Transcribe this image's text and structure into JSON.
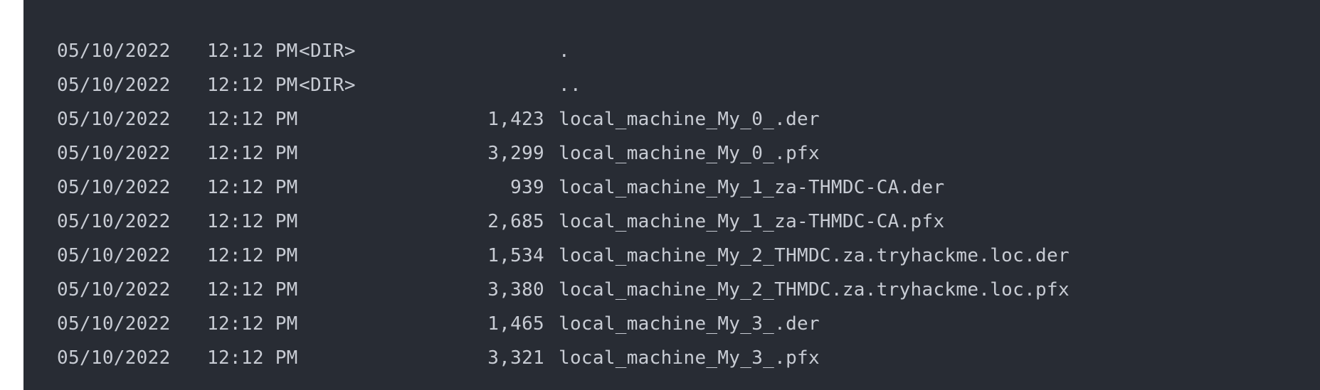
{
  "listing": {
    "rows": [
      {
        "date": "05/10/2022",
        "time": "12:12 PM",
        "dir": "<DIR>",
        "size": "",
        "name": "."
      },
      {
        "date": "05/10/2022",
        "time": "12:12 PM",
        "dir": "<DIR>",
        "size": "",
        "name": ".."
      },
      {
        "date": "05/10/2022",
        "time": "12:12 PM",
        "dir": "",
        "size": "1,423",
        "name": "local_machine_My_0_.der"
      },
      {
        "date": "05/10/2022",
        "time": "12:12 PM",
        "dir": "",
        "size": "3,299",
        "name": "local_machine_My_0_.pfx"
      },
      {
        "date": "05/10/2022",
        "time": "12:12 PM",
        "dir": "",
        "size": "939",
        "name": "local_machine_My_1_za-THMDC-CA.der"
      },
      {
        "date": "05/10/2022",
        "time": "12:12 PM",
        "dir": "",
        "size": "2,685",
        "name": "local_machine_My_1_za-THMDC-CA.pfx"
      },
      {
        "date": "05/10/2022",
        "time": "12:12 PM",
        "dir": "",
        "size": "1,534",
        "name": "local_machine_My_2_THMDC.za.tryhackme.loc.der"
      },
      {
        "date": "05/10/2022",
        "time": "12:12 PM",
        "dir": "",
        "size": "3,380",
        "name": "local_machine_My_2_THMDC.za.tryhackme.loc.pfx"
      },
      {
        "date": "05/10/2022",
        "time": "12:12 PM",
        "dir": "",
        "size": "1,465",
        "name": "local_machine_My_3_.der"
      },
      {
        "date": "05/10/2022",
        "time": "12:12 PM",
        "dir": "",
        "size": "3,321",
        "name": "local_machine_My_3_.pfx"
      }
    ]
  },
  "colors": {
    "background": "#282c34",
    "text": "#c8ccd4",
    "page": "#ffffff"
  }
}
